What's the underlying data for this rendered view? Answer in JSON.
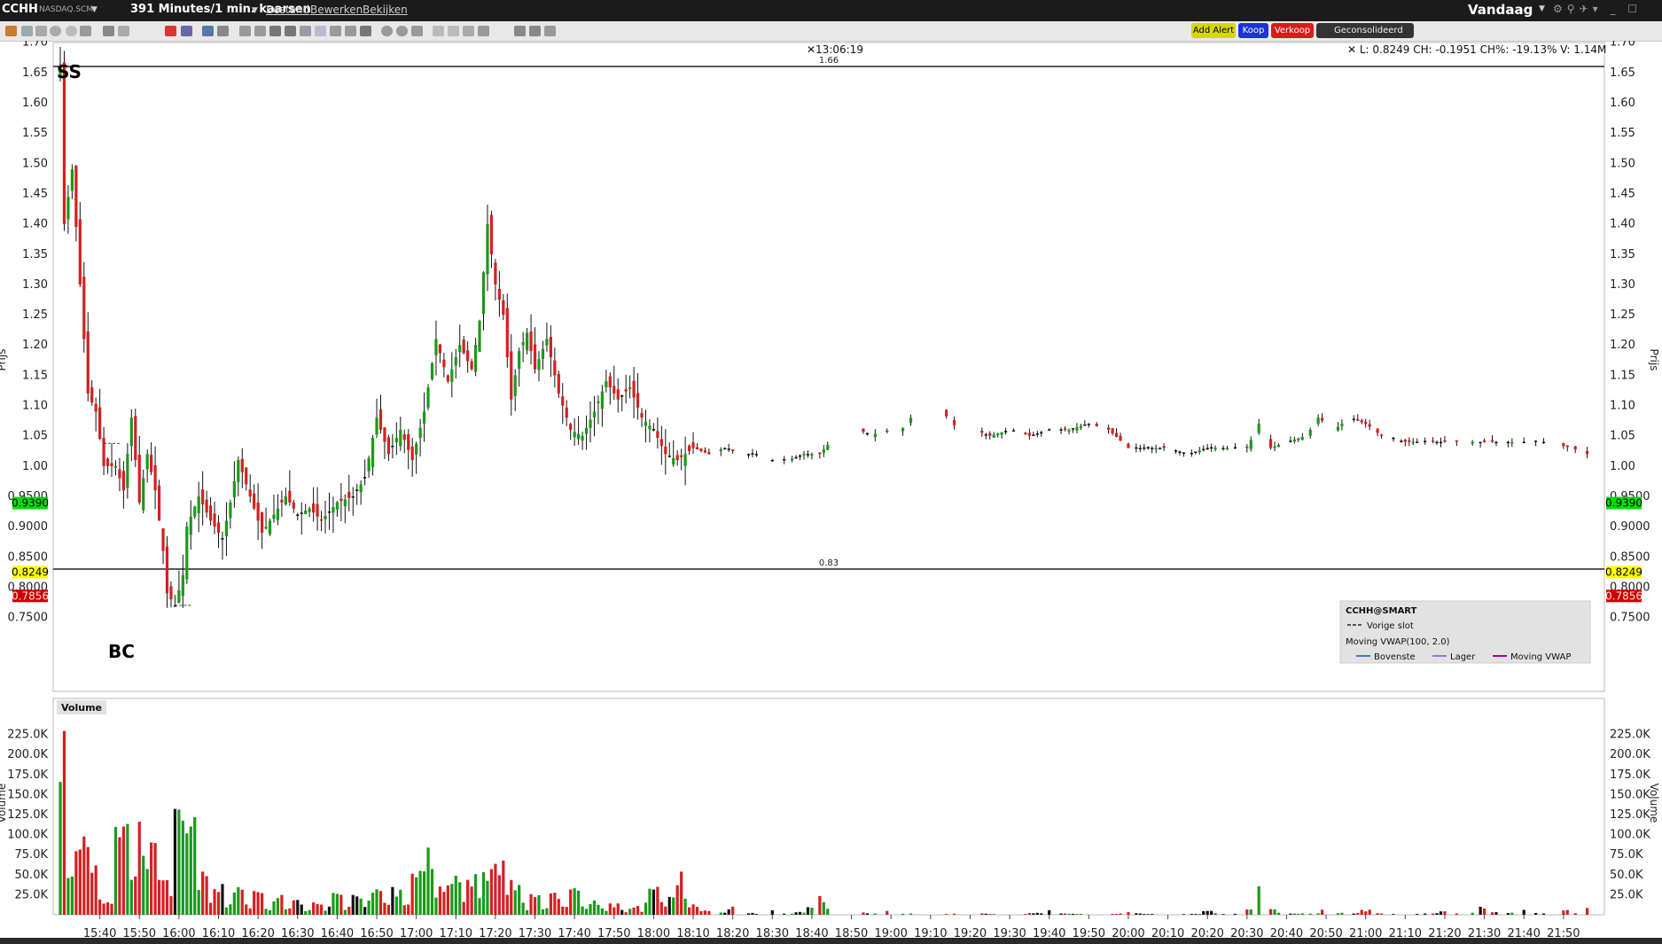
{
  "window": {
    "symbol": "CCHH",
    "exchange": "NASDAQ.SCM",
    "title": "391 Minutes/1 min. kaarsen",
    "menus": [
      "Bestand",
      "Bewerken",
      "Bekijken"
    ],
    "period": "Vandaag"
  },
  "toolbar": {
    "add_alert": "Add Alert",
    "buy": "Koop",
    "sell": "Verkoop",
    "consolidated": "Geconsolideerd"
  },
  "header": {
    "time": "13:06:19",
    "quote": "L: 0.8249 CH: -0.1951 CH%: -19.13% V: 1.14M"
  },
  "annotations": {
    "top_text": "SS",
    "bottom_text": "BC",
    "line_high_label": "1.66",
    "line_low_label": "0.83"
  },
  "legend": {
    "title": "CCHH@SMART",
    "prev_close": "Vorige slot",
    "vwap": "Moving VWAP(100, 2.0)",
    "upper": "Bovenste",
    "lower": "Lager",
    "mid": "Moving VWAP"
  },
  "price_tags": {
    "top": "0.9390",
    "mid": "0.8249",
    "bottom": "0.7856"
  },
  "volume_panel": {
    "label": "Volume"
  },
  "colors": {
    "up": "#1a9a1a",
    "down": "#d42020",
    "neutral": "#111111",
    "tag_green": "#00dd00",
    "tag_yellow": "#ffff00",
    "tag_red": "#cc0000",
    "hline": "#222222",
    "add_alert_bg": "#d7d700",
    "buy_bg": "#1a33dd",
    "sell_bg": "#dd1a1a"
  },
  "chart_data": {
    "type": "candlestick",
    "price_axis_label": "Prijs",
    "volume_axis_label": "Volume",
    "price_ticks": [
      "1.70",
      "1.65",
      "1.60",
      "1.55",
      "1.50",
      "1.45",
      "1.40",
      "1.35",
      "1.30",
      "1.25",
      "1.20",
      "1.15",
      "1.10",
      "1.05",
      "1.00",
      "0.9500",
      "0.9000",
      "0.8500",
      "0.8000",
      "0.7500"
    ],
    "price_tick_values": [
      1.7,
      1.65,
      1.6,
      1.55,
      1.5,
      1.45,
      1.4,
      1.35,
      1.3,
      1.25,
      1.2,
      1.15,
      1.1,
      1.05,
      1.0,
      0.95,
      0.9,
      0.85,
      0.8,
      0.75
    ],
    "volume_ticks": [
      "225.0K",
      "200.0K",
      "175.0K",
      "150.0K",
      "125.0K",
      "100.0K",
      "75.0K",
      "50.0K",
      "25.0K"
    ],
    "volume_tick_values": [
      225000,
      200000,
      175000,
      150000,
      125000,
      100000,
      75000,
      50000,
      25000
    ],
    "time_ticks": [
      "15:40",
      "15:50",
      "16:00",
      "16:10",
      "16:20",
      "16:30",
      "16:40",
      "16:50",
      "17:00",
      "17:10",
      "17:20",
      "17:30",
      "17:40",
      "17:50",
      "18:00",
      "18:10",
      "18:20",
      "18:30",
      "18:40",
      "18:50",
      "19:00",
      "19:10",
      "19:20",
      "19:30",
      "19:40",
      "19:50",
      "20:00",
      "20:10",
      "20:20",
      "20:30",
      "20:40",
      "20:50",
      "21:00",
      "21:10",
      "21:20",
      "21:30",
      "21:40",
      "21:50"
    ],
    "session_start": "15:30",
    "session_end": "21:59",
    "horizontal_lines": [
      1.66,
      0.83
    ],
    "prev_close": 1.02,
    "last_price": 0.8249,
    "path": [
      [
        "15:30",
        1.66
      ],
      [
        "15:31",
        1.4
      ],
      [
        "15:33",
        1.49
      ],
      [
        "15:35",
        1.3
      ],
      [
        "15:37",
        1.12
      ],
      [
        "15:39",
        1.09
      ],
      [
        "15:41",
        1.0
      ],
      [
        "15:44",
        1.0
      ],
      [
        "15:46",
        0.96
      ],
      [
        "15:48",
        1.08
      ],
      [
        "15:50",
        0.94
      ],
      [
        "15:52",
        1.02
      ],
      [
        "15:54",
        0.96
      ],
      [
        "15:56",
        0.86
      ],
      [
        "15:57",
        0.79
      ],
      [
        "15:59",
        0.77
      ],
      [
        "16:01",
        0.82
      ],
      [
        "16:02",
        0.9
      ],
      [
        "16:05",
        0.95
      ],
      [
        "16:08",
        0.91
      ],
      [
        "16:11",
        0.88
      ],
      [
        "16:13",
        0.94
      ],
      [
        "16:15",
        1.01
      ],
      [
        "16:17",
        0.97
      ],
      [
        "16:19",
        0.93
      ],
      [
        "16:21",
        0.89
      ],
      [
        "16:24",
        0.92
      ],
      [
        "16:27",
        0.95
      ],
      [
        "16:30",
        0.92
      ],
      [
        "16:33",
        0.93
      ],
      [
        "16:36",
        0.91
      ],
      [
        "16:40",
        0.94
      ],
      [
        "16:44",
        0.95
      ],
      [
        "16:47",
        0.98
      ],
      [
        "16:50",
        1.08
      ],
      [
        "16:53",
        1.02
      ],
      [
        "16:56",
        1.06
      ],
      [
        "16:59",
        1.01
      ],
      [
        "17:02",
        1.09
      ],
      [
        "17:05",
        1.21
      ],
      [
        "17:08",
        1.14
      ],
      [
        "17:11",
        1.2
      ],
      [
        "17:14",
        1.16
      ],
      [
        "17:16",
        1.24
      ],
      [
        "17:18",
        1.4
      ],
      [
        "17:20",
        1.3
      ],
      [
        "17:22",
        1.25
      ],
      [
        "17:24",
        1.11
      ],
      [
        "17:26",
        1.19
      ],
      [
        "17:28",
        1.22
      ],
      [
        "17:30",
        1.16
      ],
      [
        "17:33",
        1.21
      ],
      [
        "17:36",
        1.12
      ],
      [
        "17:39",
        1.06
      ],
      [
        "17:42",
        1.05
      ],
      [
        "17:45",
        1.09
      ],
      [
        "17:48",
        1.14
      ],
      [
        "17:51",
        1.11
      ],
      [
        "17:54",
        1.13
      ],
      [
        "17:57",
        1.08
      ],
      [
        "18:00",
        1.06
      ],
      [
        "18:03",
        1.02
      ],
      [
        "18:06",
        1.01
      ],
      [
        "18:10",
        1.03
      ],
      [
        "18:14",
        1.02
      ],
      [
        "18:18",
        1.03
      ],
      [
        "18:22",
        1.02
      ],
      [
        "18:26",
        1.02
      ],
      [
        "18:30",
        1.01
      ],
      [
        "18:34",
        1.01
      ],
      [
        "18:38",
        1.02
      ],
      [
        "18:42",
        1.02
      ],
      [
        "18:46",
        1.05
      ],
      [
        "18:49",
        1.1
      ],
      [
        "18:52",
        1.06
      ],
      [
        "18:55",
        1.05
      ],
      [
        "18:58",
        1.06
      ],
      [
        "19:01",
        1.05
      ],
      [
        "19:04",
        1.07
      ],
      [
        "19:07",
        1.1
      ],
      [
        "19:10",
        1.1
      ],
      [
        "19:13",
        1.09
      ],
      [
        "19:17",
        1.06
      ],
      [
        "19:21",
        1.06
      ],
      [
        "19:25",
        1.05
      ],
      [
        "19:30",
        1.06
      ],
      [
        "19:35",
        1.05
      ],
      [
        "19:40",
        1.06
      ],
      [
        "19:45",
        1.06
      ],
      [
        "19:50",
        1.07
      ],
      [
        "19:55",
        1.06
      ],
      [
        "20:00",
        1.03
      ],
      [
        "20:05",
        1.03
      ],
      [
        "20:10",
        1.03
      ],
      [
        "20:15",
        1.02
      ],
      [
        "20:20",
        1.03
      ],
      [
        "20:25",
        1.03
      ],
      [
        "20:30",
        1.03
      ],
      [
        "20:33",
        1.07
      ],
      [
        "20:36",
        1.03
      ],
      [
        "20:40",
        1.04
      ],
      [
        "20:45",
        1.05
      ],
      [
        "20:48",
        1.08
      ],
      [
        "20:52",
        1.06
      ],
      [
        "20:56",
        1.08
      ],
      [
        "21:00",
        1.07
      ],
      [
        "21:04",
        1.05
      ],
      [
        "21:10",
        1.04
      ],
      [
        "21:16",
        1.04
      ],
      [
        "21:22",
        1.04
      ],
      [
        "21:28",
        1.04
      ],
      [
        "21:34",
        1.04
      ],
      [
        "21:40",
        1.04
      ],
      [
        "21:46",
        1.04
      ],
      [
        "21:52",
        1.03
      ],
      [
        "21:56",
        1.02
      ],
      [
        "21:59",
        1.05
      ]
    ],
    "volume_profile": [
      [
        "15:30",
        235000
      ],
      [
        "15:32",
        50000
      ],
      [
        "15:34",
        95000
      ],
      [
        "15:36",
        110000
      ],
      [
        "15:38",
        70000
      ],
      [
        "15:42",
        20000
      ],
      [
        "15:44",
        135000
      ],
      [
        "15:46",
        120000
      ],
      [
        "15:48",
        60000
      ],
      [
        "15:50",
        115000
      ],
      [
        "15:53",
        85000
      ],
      [
        "15:56",
        60000
      ],
      [
        "16:00",
        125000
      ],
      [
        "16:03",
        115000
      ],
      [
        "16:06",
        50000
      ],
      [
        "16:10",
        35000
      ],
      [
        "16:15",
        40000
      ],
      [
        "16:20",
        30000
      ],
      [
        "16:25",
        25000
      ],
      [
        "16:30",
        20000
      ],
      [
        "16:35",
        15000
      ],
      [
        "16:40",
        25000
      ],
      [
        "16:45",
        28000
      ],
      [
        "16:50",
        45000
      ],
      [
        "16:55",
        35000
      ],
      [
        "17:00",
        55000
      ],
      [
        "17:03",
        78000
      ],
      [
        "17:07",
        40000
      ],
      [
        "17:10",
        45000
      ],
      [
        "17:14",
        55000
      ],
      [
        "17:18",
        70000
      ],
      [
        "17:21",
        65000
      ],
      [
        "17:25",
        40000
      ],
      [
        "17:30",
        25000
      ],
      [
        "17:35",
        30000
      ],
      [
        "17:40",
        40000
      ],
      [
        "17:45",
        20000
      ],
      [
        "17:50",
        15000
      ],
      [
        "17:55",
        12000
      ],
      [
        "18:00",
        40000
      ],
      [
        "18:05",
        30000
      ],
      [
        "18:06",
        55000
      ],
      [
        "18:10",
        15000
      ],
      [
        "18:20",
        10000
      ],
      [
        "18:30",
        6000
      ],
      [
        "18:40",
        10000
      ],
      [
        "18:42",
        25000
      ],
      [
        "18:50",
        10000
      ],
      [
        "19:00",
        6000
      ],
      [
        "19:20",
        5000
      ],
      [
        "19:40",
        8000
      ],
      [
        "20:00",
        5000
      ],
      [
        "20:20",
        5000
      ],
      [
        "20:30",
        6000
      ],
      [
        "20:33",
        42000
      ],
      [
        "20:36",
        8000
      ],
      [
        "20:50",
        8000
      ],
      [
        "21:00",
        6000
      ],
      [
        "21:20",
        6000
      ],
      [
        "21:30",
        10000
      ],
      [
        "21:40",
        8000
      ],
      [
        "21:50",
        6000
      ],
      [
        "21:56",
        8000
      ],
      [
        "21:59",
        15000
      ]
    ]
  }
}
